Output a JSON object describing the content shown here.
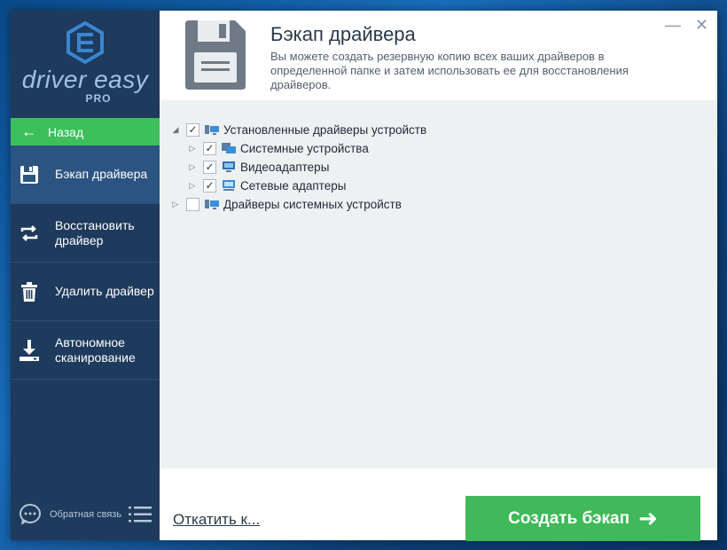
{
  "sidebar": {
    "logo_text": "driver easy",
    "logo_pro": "PRO",
    "back_label": "Назад",
    "items": [
      {
        "label": "Бэкап драйвера",
        "icon": "floppy-icon",
        "active": true
      },
      {
        "label": "Восстановить\nдрайвер",
        "icon": "restore-icon",
        "active": false
      },
      {
        "label": "Удалить драйвер",
        "icon": "trash-icon",
        "active": false
      },
      {
        "label": "Автономное\nсканирование",
        "icon": "download-icon",
        "active": false
      }
    ],
    "feedback_label": "Обратная связь"
  },
  "header": {
    "title": "Бэкап драйвера",
    "description": "Вы можете создать резервную копию всех ваших драйверов в определенной папке и затем использовать ее для восстановления драйверов."
  },
  "tree": {
    "installed": {
      "label": "Установленные драйверы устройств",
      "checked": true,
      "expanded": true
    },
    "children": [
      {
        "label": "Системные устройства",
        "checked": true
      },
      {
        "label": "Видеоадаптеры",
        "checked": true
      },
      {
        "label": "Сетевые адаптеры",
        "checked": true
      }
    ],
    "system": {
      "label": "Драйверы системных устройств",
      "checked": false,
      "expanded": false
    }
  },
  "footer": {
    "rollback_label": "Откатить к...",
    "create_label": "Создать бэкап"
  },
  "colors": {
    "sidebar": "#1e3a5c",
    "sidebar_active": "#2c5482",
    "accent_green": "#3fb95a",
    "tree_bg": "#edf1f2"
  }
}
